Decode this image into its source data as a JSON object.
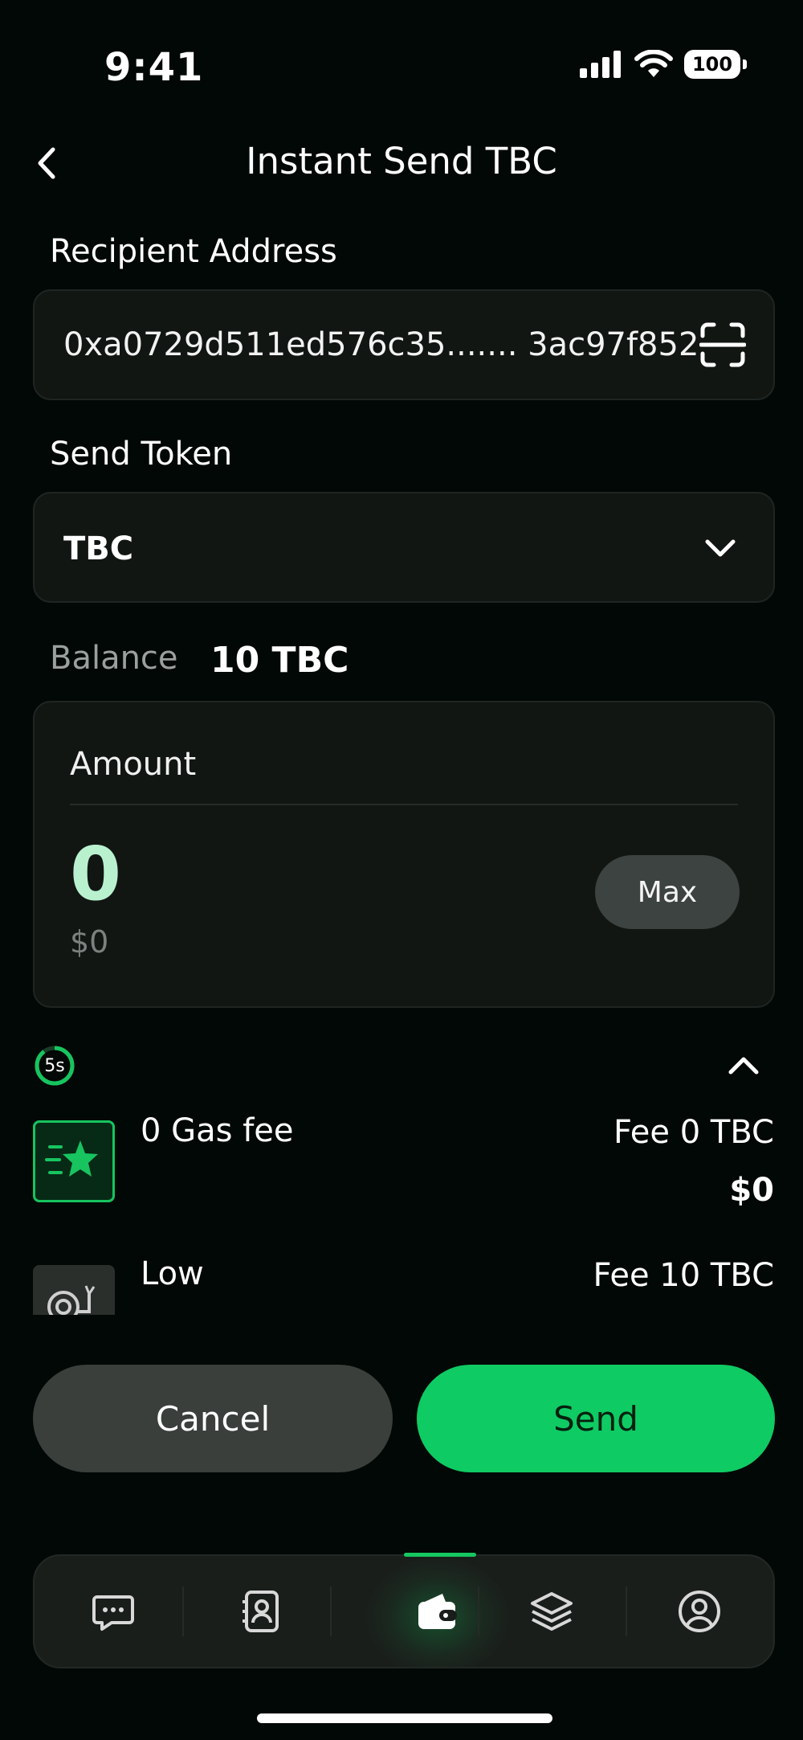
{
  "status_bar": {
    "time": "9:41",
    "battery": "100"
  },
  "header": {
    "title": "Instant Send TBC"
  },
  "recipient": {
    "label": "Recipient Address",
    "value": "0xa0729d511ed576c35....... 3ac97f852"
  },
  "token": {
    "label": "Send Token",
    "selected": "TBC"
  },
  "balance": {
    "label": "Balance",
    "value": "10 TBC"
  },
  "amount": {
    "label": "Amount",
    "value": "0",
    "usd": "$0",
    "max_label": "Max"
  },
  "fee_section": {
    "timer": "5s"
  },
  "fee_options": [
    {
      "name": "0 Gas fee",
      "fee": "Fee 0 TBC",
      "usd": "$0",
      "selected": true
    },
    {
      "name": "Low",
      "fee": "Fee 10 TBC"
    }
  ],
  "actions": {
    "cancel_label": "Cancel",
    "send_label": "Send"
  },
  "bottom_nav": [
    {
      "icon": "chat-icon"
    },
    {
      "icon": "contacts-icon"
    },
    {
      "icon": "wallet-icon",
      "active": true
    },
    {
      "icon": "layers-icon"
    },
    {
      "icon": "profile-icon"
    }
  ],
  "colors": {
    "accent": "#0fcb63",
    "background": "#020805",
    "card": "#121613"
  }
}
